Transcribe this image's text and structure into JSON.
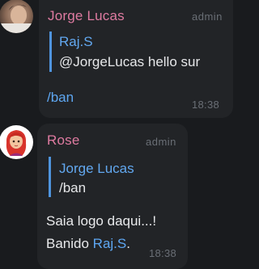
{
  "messages": [
    {
      "sender": "Jorge Lucas",
      "sender_color": "#df7ba1",
      "badge": "admin",
      "reply": {
        "author": "Raj.S",
        "text": "@JorgeLucas hello sur"
      },
      "text": "/ban",
      "text_color": "#5ea7f2",
      "time": "18:38"
    },
    {
      "sender": "Rose",
      "sender_color": "#df7ba1",
      "badge": "admin",
      "reply": {
        "author": "Jorge Lucas",
        "text": "/ban"
      },
      "line1": "Saia logo daqui...!",
      "line2_prefix": "Banido ",
      "line2_link": "Raj.S",
      "line2_suffix": ".",
      "time": "18:38"
    }
  ],
  "colors": {
    "background": "#191b1e",
    "bubble": "#222427",
    "link": "#5ea7f2",
    "reply_bar": "#4f94de"
  },
  "icons": {
    "avatar_1": "user-photo-avatar",
    "avatar_2": "rose-bot-cartoon-avatar"
  }
}
